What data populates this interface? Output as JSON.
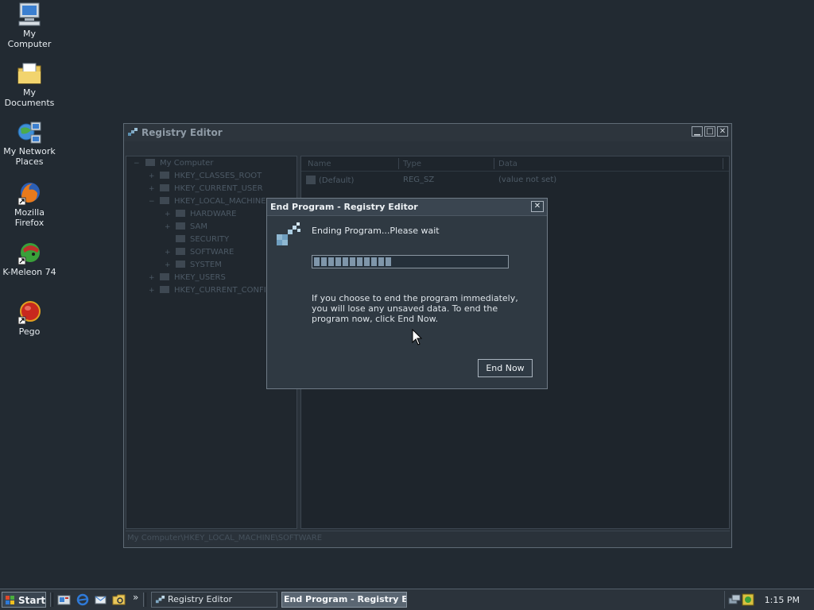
{
  "desktop": {
    "icons": [
      {
        "label": "My Computer"
      },
      {
        "label": "My Documents"
      },
      {
        "label": "My Network Places"
      },
      {
        "label": "Mozilla Firefox"
      },
      {
        "label": "K-Meleon 74"
      },
      {
        "label": "Pego"
      }
    ]
  },
  "regedit": {
    "title": "Registry Editor",
    "tree": {
      "root": "My Computer",
      "items": [
        "HKEY_CLASSES_ROOT",
        "HKEY_CURRENT_USER",
        "HKEY_LOCAL_MACHINE",
        "HARDWARE",
        "SAM",
        "SECURITY",
        "SOFTWARE",
        "SYSTEM",
        "HKEY_USERS",
        "HKEY_CURRENT_CONFI"
      ]
    },
    "columns": {
      "name": "Name",
      "type": "Type",
      "data": "Data"
    },
    "row": {
      "name": "(Default)",
      "type": "REG_SZ",
      "data": "(value not set)"
    },
    "status": "My Computer\\HKEY_LOCAL_MACHINE\\SOFTWARE"
  },
  "dialog": {
    "title": "End Program - Registry Editor",
    "close": "✕",
    "message": "Ending Program...Please wait",
    "progress_percent": 40,
    "info": "If you choose to end the program immediately, you will lose any unsaved data. To end the program now, click End Now.",
    "button": "End Now"
  },
  "taskbar": {
    "start": "Start",
    "more": "»",
    "tasks": [
      "Registry Editor",
      "End Program - Registry E..."
    ],
    "clock": "1:15 PM"
  },
  "colors": {
    "desktop": "#222a32",
    "dialog_bg": "#2f3942",
    "progress": "#7f96aa"
  }
}
